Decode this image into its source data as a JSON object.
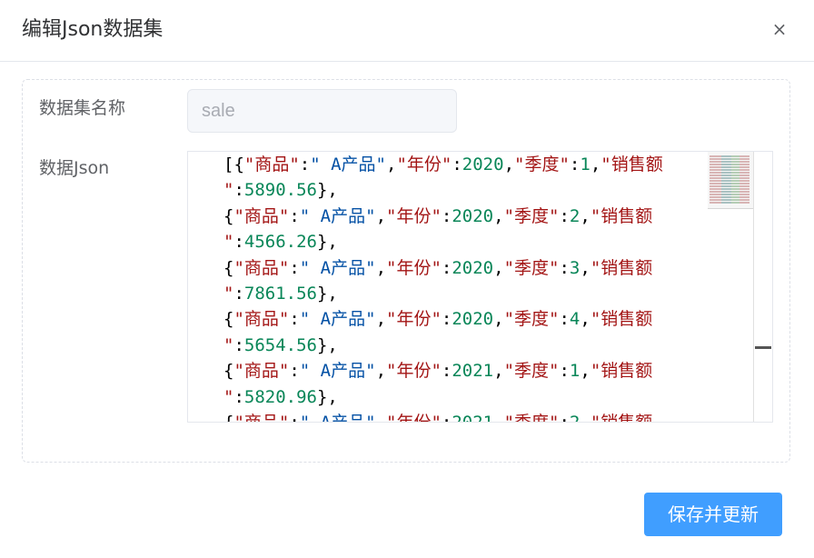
{
  "dialog": {
    "title": "编辑Json数据集",
    "close_symbol": "×"
  },
  "form": {
    "name_label": "数据集名称",
    "name_value": "sale",
    "json_label": "数据Json"
  },
  "json_records": [
    {
      "product": " A产品",
      "year": "2020",
      "quarter": "1",
      "sales": "5890.56"
    },
    {
      "product": " A产品",
      "year": "2020",
      "quarter": "2",
      "sales": "4566.26"
    },
    {
      "product": " A产品",
      "year": "2020",
      "quarter": "3",
      "sales": "7861.56"
    },
    {
      "product": " A产品",
      "year": "2020",
      "quarter": "4",
      "sales": "5654.56"
    },
    {
      "product": " A产品",
      "year": "2021",
      "quarter": "1",
      "sales": "5820.96"
    },
    {
      "product": " A产品",
      "year": "2021",
      "quarter": "2",
      "sales": ""
    }
  ],
  "json_keys": {
    "product": "商品",
    "year": "年份",
    "quarter": "季度",
    "sales": "销售额"
  },
  "footer": {
    "save_label": "保存并更新"
  },
  "colors": {
    "primary": "#409eff",
    "json_key": "#a31515",
    "json_string": "#0451a5",
    "json_number": "#098658"
  }
}
